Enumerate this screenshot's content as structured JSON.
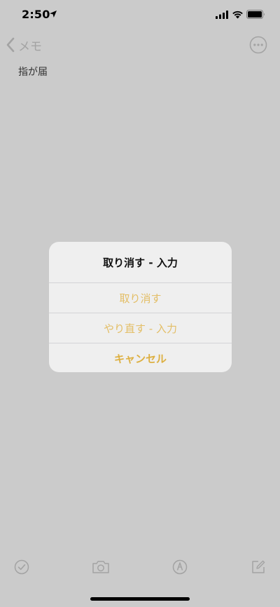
{
  "status_bar": {
    "time": "2:50"
  },
  "nav": {
    "back_label": "メモ"
  },
  "note": {
    "text": "指が届"
  },
  "dialog": {
    "title": "取り消す - 入力",
    "undo_label": "取り消す",
    "redo_label": "やり直す - 入力",
    "cancel_label": "キャンセル"
  },
  "colors": {
    "background": "#cbcbcb",
    "accent": "#ddb042",
    "accent_light": "#e3be66",
    "dialog_background": "#efefef"
  },
  "icons": {
    "status": [
      "location-arrow-icon",
      "cellular-signal-icon",
      "wifi-icon",
      "battery-icon"
    ],
    "toolbar": [
      "checklist-icon",
      "camera-icon",
      "markup-pen-icon",
      "compose-icon"
    ]
  }
}
